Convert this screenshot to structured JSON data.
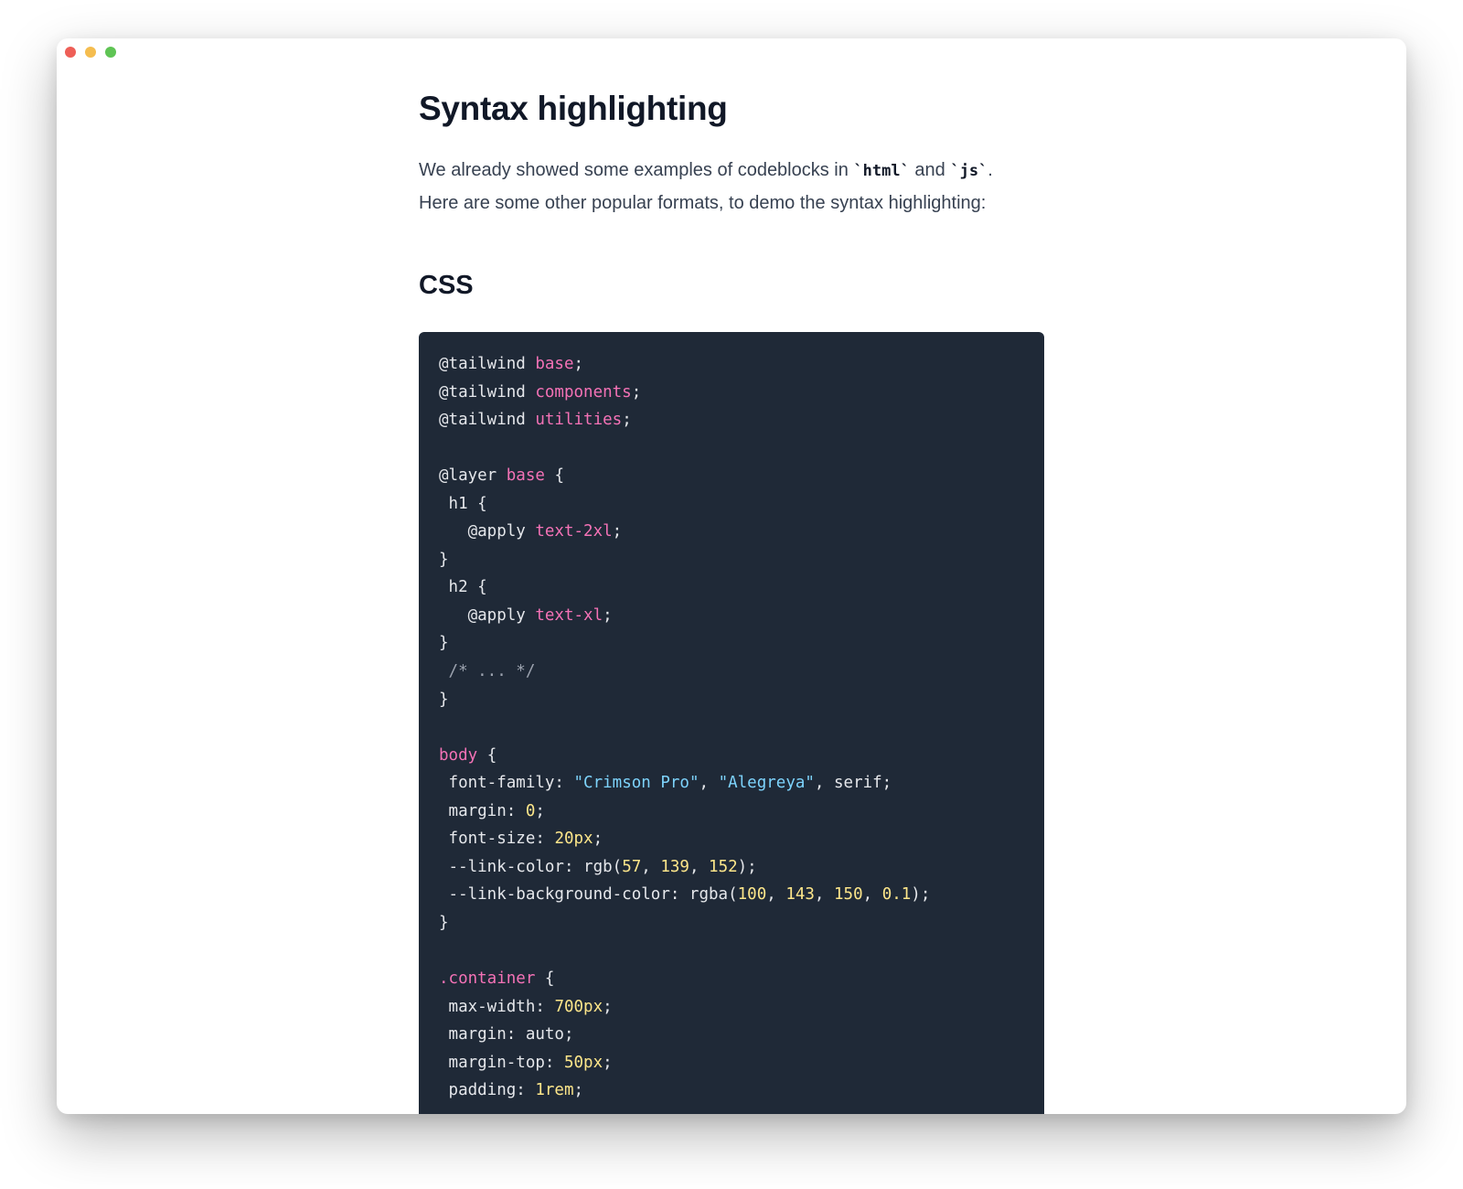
{
  "window": {
    "controls": [
      {
        "name": "close",
        "color": "#ee5f57"
      },
      {
        "name": "minimize",
        "color": "#f5bd4f"
      },
      {
        "name": "maximize",
        "color": "#5fc454"
      }
    ]
  },
  "article": {
    "title": "Syntax highlighting",
    "intro": {
      "part1": "We already showed some examples of codeblocks in ",
      "code1": "`html`",
      "part2": " and ",
      "code2": "`js`",
      "part3": ".",
      "line2": "Here are some other popular formats, to demo the syntax highlighting:"
    },
    "section_title": "CSS"
  },
  "colors": {
    "code_background": "#1f2937",
    "token_plain": "#e5e7eb",
    "token_keyword": "#f472b6",
    "token_string": "#7dd3fc",
    "token_number": "#fde68a",
    "token_comment": "#9ca3af"
  },
  "code_lines": [
    [
      [
        "plain",
        "@tailwind "
      ],
      [
        "pink",
        "base"
      ],
      [
        "plain",
        ";"
      ]
    ],
    [
      [
        "plain",
        "@tailwind "
      ],
      [
        "pink",
        "components"
      ],
      [
        "plain",
        ";"
      ]
    ],
    [
      [
        "plain",
        "@tailwind "
      ],
      [
        "pink",
        "utilities"
      ],
      [
        "plain",
        ";"
      ]
    ],
    [],
    [
      [
        "plain",
        "@layer "
      ],
      [
        "pink",
        "base"
      ],
      [
        "plain",
        " {"
      ]
    ],
    [
      [
        "plain",
        " h1 {"
      ]
    ],
    [
      [
        "plain",
        "   @apply "
      ],
      [
        "pink",
        "text-2xl"
      ],
      [
        "plain",
        ";"
      ]
    ],
    [
      [
        "plain",
        "}"
      ]
    ],
    [
      [
        "plain",
        " h2 {"
      ]
    ],
    [
      [
        "plain",
        "   @apply "
      ],
      [
        "pink",
        "text-xl"
      ],
      [
        "plain",
        ";"
      ]
    ],
    [
      [
        "plain",
        "}"
      ]
    ],
    [
      [
        "comment",
        " /* ... */"
      ]
    ],
    [
      [
        "plain",
        "}"
      ]
    ],
    [],
    [
      [
        "pink",
        "body"
      ],
      [
        "plain",
        " {"
      ]
    ],
    [
      [
        "plain",
        " font-family: "
      ],
      [
        "blue",
        "\"Crimson Pro\""
      ],
      [
        "plain",
        ", "
      ],
      [
        "blue",
        "\"Alegreya\""
      ],
      [
        "plain",
        ", serif;"
      ]
    ],
    [
      [
        "plain",
        " margin: "
      ],
      [
        "yellow",
        "0"
      ],
      [
        "plain",
        ";"
      ]
    ],
    [
      [
        "plain",
        " font-size: "
      ],
      [
        "yellow",
        "20px"
      ],
      [
        "plain",
        ";"
      ]
    ],
    [
      [
        "plain",
        " --link-color: rgb("
      ],
      [
        "yellow",
        "57"
      ],
      [
        "plain",
        ", "
      ],
      [
        "yellow",
        "139"
      ],
      [
        "plain",
        ", "
      ],
      [
        "yellow",
        "152"
      ],
      [
        "plain",
        ");"
      ]
    ],
    [
      [
        "plain",
        " --link-background-color: rgba("
      ],
      [
        "yellow",
        "100"
      ],
      [
        "plain",
        ", "
      ],
      [
        "yellow",
        "143"
      ],
      [
        "plain",
        ", "
      ],
      [
        "yellow",
        "150"
      ],
      [
        "plain",
        ", "
      ],
      [
        "yellow",
        "0.1"
      ],
      [
        "plain",
        ");"
      ]
    ],
    [
      [
        "plain",
        "}"
      ]
    ],
    [],
    [
      [
        "pink",
        ".container"
      ],
      [
        "plain",
        " {"
      ]
    ],
    [
      [
        "plain",
        " max-width: "
      ],
      [
        "yellow",
        "700px"
      ],
      [
        "plain",
        ";"
      ]
    ],
    [
      [
        "plain",
        " margin: auto;"
      ]
    ],
    [
      [
        "plain",
        " margin-top: "
      ],
      [
        "yellow",
        "50px"
      ],
      [
        "plain",
        ";"
      ]
    ],
    [
      [
        "plain",
        " padding: "
      ],
      [
        "yellow",
        "1rem"
      ],
      [
        "plain",
        ";"
      ]
    ]
  ]
}
